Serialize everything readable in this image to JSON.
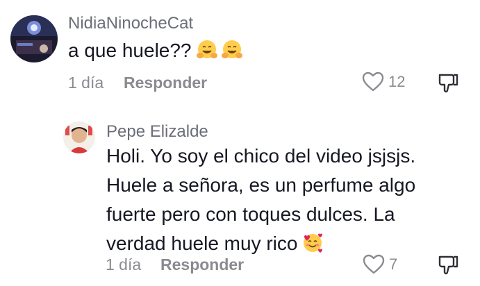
{
  "comments": [
    {
      "username": "NidiaNinocheCat",
      "text": "a que huele??",
      "emojis": [
        "hugging-face",
        "hugging-face"
      ],
      "time": "1 día",
      "reply_label": "Responder",
      "likes": "12"
    },
    {
      "username": "Pepe Elizalde",
      "lines": [
        "Holi. Yo soy el chico del video jsjsjs.",
        "Huele a señora, es un perfume algo",
        "fuerte pero con toques dulces. La",
        "verdad huele muy rico"
      ],
      "emojis": [
        "smiling-face-with-hearts"
      ],
      "time": "1 día",
      "reply_label": "Responder",
      "likes": "7"
    }
  ],
  "colors": {
    "text": "#161823",
    "meta": "#8a8b91",
    "username": "#6b6d78",
    "emoji_yellow": "#ffcc4d"
  }
}
